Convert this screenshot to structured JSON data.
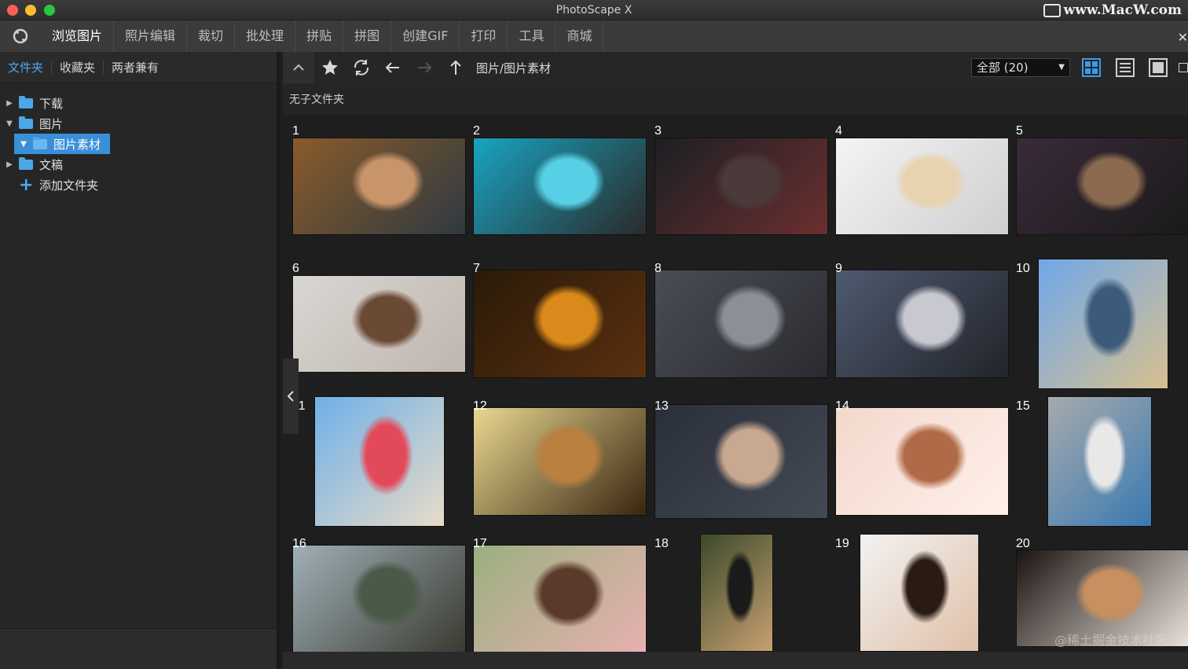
{
  "window": {
    "title": "PhotoScape X",
    "watermark_top": "www.MacW.com",
    "watermark_bottom": "@稀土掘金技术社区"
  },
  "menu": {
    "items": [
      "浏览图片",
      "照片编辑",
      "裁切",
      "批处理",
      "拼贴",
      "拼图",
      "创建GIF",
      "打印",
      "工具",
      "商城"
    ],
    "active_index": 0
  },
  "sidebar": {
    "tabs": [
      "文件夹",
      "收藏夹",
      "两者兼有"
    ],
    "active_tab": 0,
    "tree": [
      {
        "label": "下载",
        "expanded": false
      },
      {
        "label": "图片",
        "expanded": true
      },
      {
        "label": "图片素材",
        "selected": true
      },
      {
        "label": "文稿",
        "expanded": false
      },
      {
        "label": "添加文件夹"
      }
    ]
  },
  "toolbar": {
    "path": "图片/图片素材",
    "filter_value": "全部 (20)",
    "subfolder_text": "无子文件夹"
  },
  "thumbnails": [
    {
      "num": "1",
      "colors": [
        "#8b5a2b",
        "#c8946a",
        "#2e3a40"
      ]
    },
    {
      "num": "2",
      "colors": [
        "#18a4c0",
        "#57d0e6",
        "#2a2a2a"
      ]
    },
    {
      "num": "3",
      "colors": [
        "#1d1f24",
        "#4a3a3a",
        "#6b2f2f"
      ]
    },
    {
      "num": "4",
      "colors": [
        "#f4f4f4",
        "#e8d3b0",
        "#cfcfcf"
      ]
    },
    {
      "num": "5",
      "colors": [
        "#3a2a3a",
        "#8b6a50",
        "#1a1a1a"
      ]
    },
    {
      "num": "6",
      "colors": [
        "#d9d6d2",
        "#6b4a35",
        "#bfb6ae"
      ]
    },
    {
      "num": "7",
      "colors": [
        "#2a1a08",
        "#d98a1a",
        "#5a3010"
      ]
    },
    {
      "num": "8",
      "colors": [
        "#4a4d55",
        "#8d8f96",
        "#2a2b30"
      ]
    },
    {
      "num": "9",
      "colors": [
        "#4e5a70",
        "#c8c8d0",
        "#22242a"
      ]
    },
    {
      "num": "10",
      "colors": [
        "#6fa8e8",
        "#3c5a7a",
        "#d8c090"
      ]
    },
    {
      "num": "11",
      "colors": [
        "#6fb0e8",
        "#e24a5a",
        "#e8dcc8"
      ]
    },
    {
      "num": "12",
      "colors": [
        "#e8d890",
        "#b98040",
        "#3a2410"
      ]
    },
    {
      "num": "13",
      "colors": [
        "#2a2f3a",
        "#c8a890",
        "#444a55"
      ]
    },
    {
      "num": "14",
      "colors": [
        "#f3d8cc",
        "#b06a48",
        "#fff0ea"
      ]
    },
    {
      "num": "15",
      "colors": [
        "#a8aaae",
        "#e8e8e8",
        "#3a7ab0"
      ]
    },
    {
      "num": "16",
      "colors": [
        "#9fb0b8",
        "#4a5a48",
        "#3a3a30"
      ]
    },
    {
      "num": "17",
      "colors": [
        "#9ab080",
        "#5a3a2a",
        "#e8b0b0"
      ]
    },
    {
      "num": "18",
      "colors": [
        "#3a4a2a",
        "#1a1a1a",
        "#c8a070"
      ]
    },
    {
      "num": "19",
      "colors": [
        "#f2f2f2",
        "#2a1a14",
        "#e0c0a8"
      ]
    },
    {
      "num": "20",
      "colors": [
        "#1a1412",
        "#c89060",
        "#e8e0d8"
      ]
    }
  ]
}
